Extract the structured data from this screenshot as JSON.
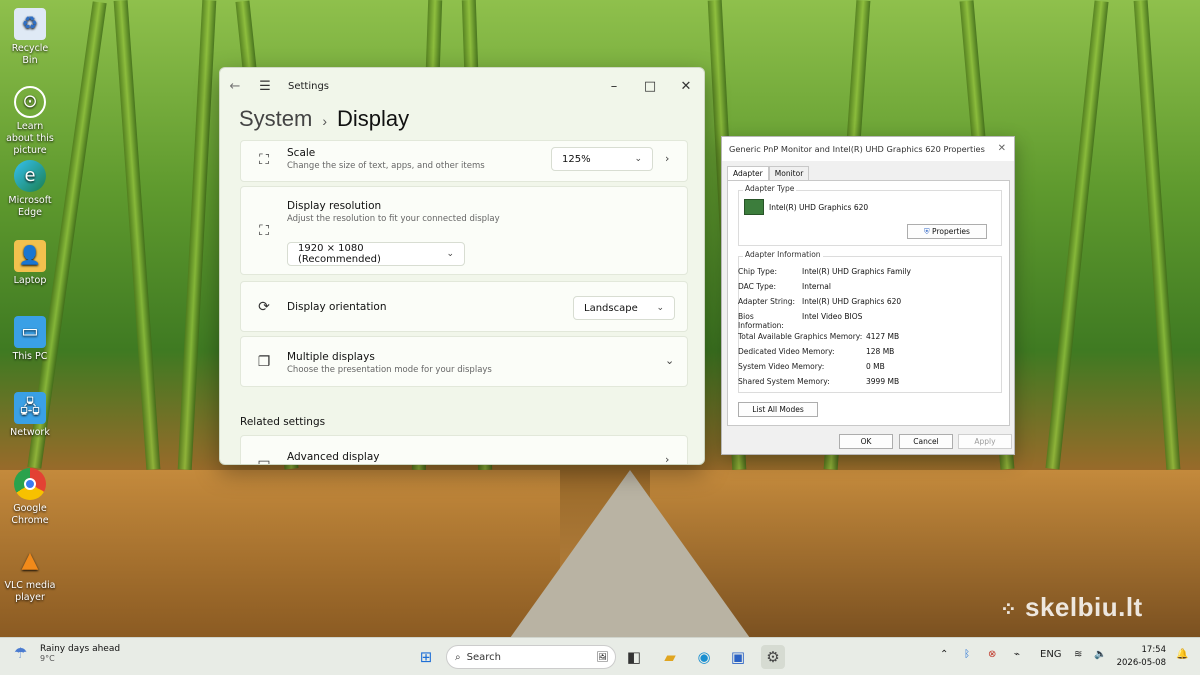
{
  "desktop": {
    "icons": [
      {
        "label": "Recycle Bin"
      },
      {
        "label": "Learn about this picture"
      },
      {
        "label": "Microsoft Edge"
      },
      {
        "label": "Laptop"
      },
      {
        "label": "This PC"
      },
      {
        "label": "Network"
      },
      {
        "label": "Google Chrome"
      },
      {
        "label": "VLC media player"
      }
    ],
    "watermark": "skelbiu.lt"
  },
  "settings": {
    "window_title": "Settings",
    "breadcrumb_parent": "System",
    "breadcrumb_separator": "›",
    "breadcrumb_current": "Display",
    "scale": {
      "title": "Scale",
      "subtitle": "Change the size of text, apps, and other items",
      "value": "125%"
    },
    "resolution": {
      "title": "Display resolution",
      "subtitle": "Adjust the resolution to fit your connected display",
      "value": "1920 × 1080 (Recommended)"
    },
    "orientation": {
      "title": "Display orientation",
      "value": "Landscape"
    },
    "multiple": {
      "title": "Multiple displays",
      "subtitle": "Choose the presentation mode for your displays"
    },
    "related_heading": "Related settings",
    "advanced": {
      "title": "Advanced display"
    }
  },
  "props": {
    "title": "Generic PnP Monitor and Intel(R) UHD Graphics 620 Properties",
    "tabs": [
      "Adapter",
      "Monitor"
    ],
    "adapter_type_label": "Adapter Type",
    "adapter_name": "Intel(R) UHD Graphics 620",
    "properties_button": "Properties",
    "adapter_info_label": "Adapter Information",
    "info": [
      {
        "k": "Chip Type:",
        "v": "Intel(R) UHD Graphics Family"
      },
      {
        "k": "DAC Type:",
        "v": "Internal"
      },
      {
        "k": "Adapter String:",
        "v": "Intel(R) UHD Graphics 620"
      },
      {
        "k": "Bios Information:",
        "v": "Intel Video BIOS"
      }
    ],
    "memory": [
      {
        "k": "Total Available Graphics Memory:",
        "v": "4127 MB"
      },
      {
        "k": "Dedicated Video Memory:",
        "v": "128 MB"
      },
      {
        "k": "System Video Memory:",
        "v": "0 MB"
      },
      {
        "k": "Shared System Memory:",
        "v": "3999 MB"
      }
    ],
    "list_modes_button": "List All Modes",
    "ok": "OK",
    "cancel": "Cancel",
    "apply": "Apply"
  },
  "taskbar": {
    "weather_title": "Rainy days ahead",
    "weather_temp": "9°C",
    "search_placeholder": "Search",
    "language": "ENG",
    "time": "17:54",
    "date": "2026-05-08"
  }
}
